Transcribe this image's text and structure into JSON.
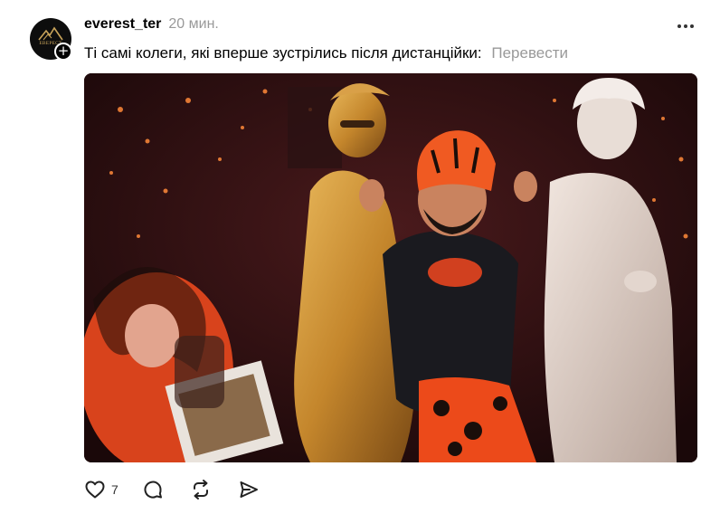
{
  "post": {
    "avatar": {
      "logo_text": "ЕВЕРЕСТ",
      "follow_symbol": "+"
    },
    "username": "everest_ter",
    "timestamp": "20 мин.",
    "caption": "Ті самі колеги, які вперше зустрілись після дистанційки:",
    "translate_label": "Перевести",
    "media": {
      "description_icon": "video-frame"
    },
    "actions": {
      "like_count": "7",
      "like_icon": "heart-icon",
      "comment_icon": "comment-icon",
      "repost_icon": "repost-icon",
      "share_icon": "share-icon"
    }
  }
}
